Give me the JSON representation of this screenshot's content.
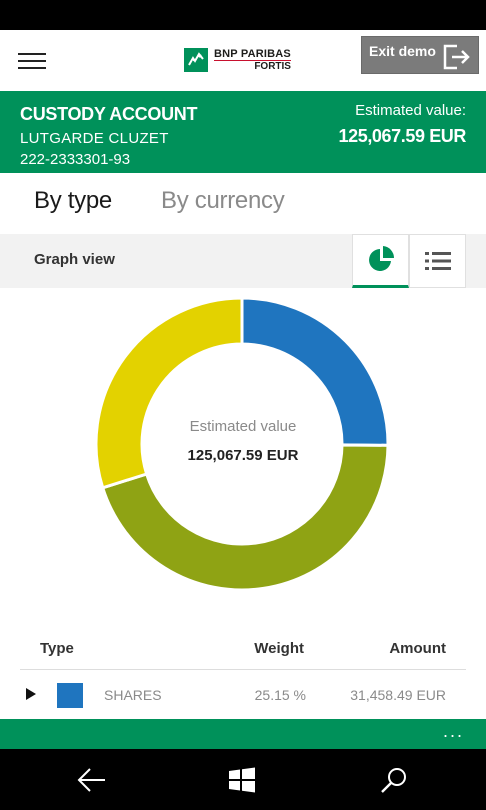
{
  "header": {
    "menu_icon": "hamburger-icon",
    "logo": {
      "line1": "BNP PARIBAS",
      "line2": "FORTIS"
    },
    "exit_label": "Exit demo",
    "exit_icon": "exit-icon"
  },
  "account": {
    "title": "CUSTODY ACCOUNT",
    "holder": "LUTGARDE CLUZET",
    "number": "222-2333301-93",
    "estimated_label": "Estimated value:",
    "estimated_value": "125,067.59 EUR"
  },
  "tabs": [
    {
      "label": "By type",
      "active": true
    },
    {
      "label": "By currency",
      "active": false
    }
  ],
  "view": {
    "label": "Graph view",
    "graph_icon": "pie-chart-icon",
    "list_icon": "list-icon",
    "selected": "graph"
  },
  "chart_data": {
    "type": "pie",
    "donut": true,
    "center_label": "Estimated value",
    "center_value": "125,067.59 EUR",
    "slices": [
      {
        "name": "SHARES",
        "value": 25.15,
        "color": "#1f75bf"
      },
      {
        "value": 45.0,
        "color": "#8fa314"
      },
      {
        "value": 29.85,
        "color": "#e3d200"
      }
    ]
  },
  "table": {
    "headers": {
      "type": "Type",
      "weight": "Weight",
      "amount": "Amount"
    },
    "rows": [
      {
        "type": "SHARES",
        "weight": "25.15 %",
        "amount": "31,458.49 EUR",
        "color": "#1f75bf"
      }
    ]
  },
  "appbar": {
    "more_label": "..."
  },
  "navbar": {
    "back_icon": "back-arrow-icon",
    "home_icon": "windows-logo-icon",
    "search_icon": "search-icon"
  },
  "colors": {
    "brand": "#00915a",
    "shares": "#1f75bf"
  }
}
